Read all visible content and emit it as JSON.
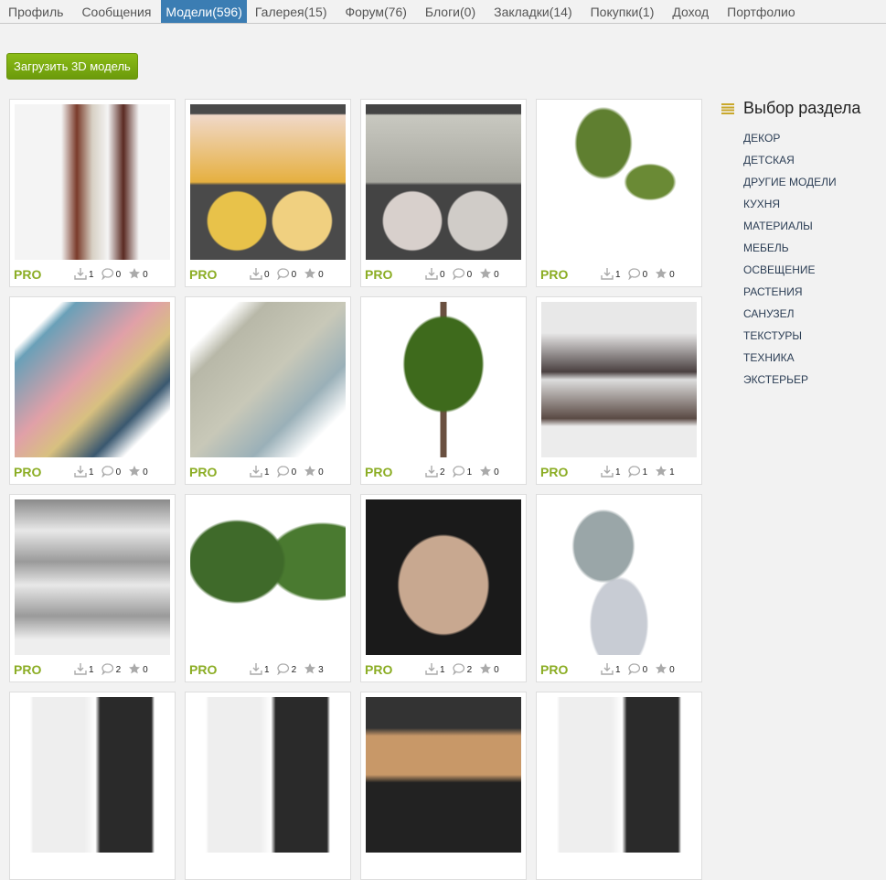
{
  "nav": [
    {
      "label": "Профиль"
    },
    {
      "label": "Сообщения"
    },
    {
      "label": "Модели(596)",
      "active": true
    },
    {
      "label": "Галерея(15)"
    },
    {
      "label": "Форум(76)"
    },
    {
      "label": "Блоги(0)"
    },
    {
      "label": "Закладки(14)"
    },
    {
      "label": "Покупки(1)"
    },
    {
      "label": "Доход"
    },
    {
      "label": "Портфолио"
    }
  ],
  "upload_label": "Загрузить 3D модель",
  "pro_label": "PRO",
  "models": [
    {
      "thumb": "pendant-lamps",
      "downloads": "1",
      "comments": "0",
      "likes": "0",
      "bg": "linear-gradient(90deg,#f4f4f4 30%,#7a3b2a 40%,#d7d0c4 50%,#f4f4f4 60%,#5a2a22 70%,#f4f4f4 80%)"
    },
    {
      "thumb": "abstract-paintings-yellow",
      "downloads": "0",
      "comments": "0",
      "likes": "0",
      "bg": "radial-gradient(circle at 30% 75%,#e8c24a 18%,transparent 19%),radial-gradient(circle at 72% 75%,#f0d080 18%,transparent 19%),linear-gradient(#4a4a4a 6%,#f0d8c8 7%,#e6b040 50%,#4a4a4a 52%)"
    },
    {
      "thumb": "abstract-paintings-grey",
      "downloads": "0",
      "comments": "0",
      "likes": "0",
      "bg": "radial-gradient(circle at 30% 75%,#d8d0cc 18%,transparent 19%),radial-gradient(circle at 72% 75%,#d0ccc8 18%,transparent 19%),linear-gradient(#444 6%,#c8c8c0 7%,#a8a8a0 50%,#444 52%)"
    },
    {
      "thumb": "palm-trees",
      "downloads": "1",
      "comments": "0",
      "likes": "0",
      "bg": "radial-gradient(ellipse at 40% 25%,#5f7f30 20%,transparent 22%),radial-gradient(ellipse at 70% 50%,#6a8a35 15%,transparent 17%),#fff"
    },
    {
      "thumb": "rugs-colorful",
      "downloads": "1",
      "comments": "0",
      "likes": "0",
      "bg": "linear-gradient(135deg,#fff 15%,#6aa0b8 20%,#e0a0a8 45%,#d8c080 60%,#3a5870 75%,#fff 85%)"
    },
    {
      "thumb": "rugs-vintage",
      "downloads": "1",
      "comments": "0",
      "likes": "0",
      "bg": "linear-gradient(135deg,#fff 15%,#b8b8a8 25%,#c8c8b8 50%,#9ab0b8 70%,#fff 85%)"
    },
    {
      "thumb": "tree",
      "downloads": "2",
      "comments": "1",
      "likes": "0",
      "bg": "radial-gradient(ellipse at 50% 40%,#3e6a1c 35%,transparent 37%),linear-gradient(90deg,transparent 48%,#6a5040 48%,#6a5040 52%,transparent 52%),#fff"
    },
    {
      "thumb": "kitchen",
      "downloads": "1",
      "comments": "1",
      "likes": "1",
      "bg": "linear-gradient(#e8e8e8 20%,#4a4040 45%,#ddd 50%,#5a4a44 75%,#ececec 80%)"
    },
    {
      "thumb": "sofas",
      "downloads": "1",
      "comments": "2",
      "likes": "0",
      "bg": "linear-gradient(#8a8a8a,#e8e8e8 20%,#9a9a9a 40%,#e8e8e8 55%,#9a9a9a 75%,#eee 90%)"
    },
    {
      "thumb": "potted-palms",
      "downloads": "1",
      "comments": "2",
      "likes": "3",
      "bg": "radial-gradient(ellipse at 30% 40%,#3f6a2a 30%,transparent 32%),radial-gradient(ellipse at 85% 40%,#4a7a30 28%,transparent 30%),#fff"
    },
    {
      "thumb": "brick-bbq",
      "downloads": "1",
      "comments": "2",
      "likes": "0",
      "bg": "radial-gradient(ellipse at 50% 55%,#c8a890 40%,transparent 42%),#1a1a1a"
    },
    {
      "thumb": "tables",
      "downloads": "1",
      "comments": "0",
      "likes": "0",
      "bg": "radial-gradient(ellipse at 40% 30%,#9aa6a8 22%,transparent 24%),radial-gradient(ellipse at 50% 80%,#c8ccd4 25%,transparent 27%),#fff"
    },
    {
      "thumb": "doors-white-black",
      "bg": "linear-gradient(90deg,#fff 10%,#eee 12%,#eee 45%,#fff 52%,#2a2a2a 55%,#2a2a2a 88%,#fff 90%)"
    },
    {
      "thumb": "doors-louvered",
      "bg": "linear-gradient(90deg,#fff 10%,#eee 12%,#eee 45%,#fff 52%,#2a2a2a 55%,#2a2a2a 88%,#fff 90%)"
    },
    {
      "thumb": "kitchen-dark",
      "bg": "linear-gradient(#333 20%,#c89868 25%,#c89868 50%,#222 55%)"
    },
    {
      "thumb": "doors-white-black-2",
      "bg": "linear-gradient(90deg,#fff 10%,#eee 12%,#eee 45%,#fff 52%,#2a2a2a 55%,#2a2a2a 88%,#fff 90%)"
    }
  ],
  "sidebar": {
    "title": "Выбор раздела",
    "items": [
      "ДЕКОР",
      "ДЕТСКАЯ",
      "ДРУГИЕ МОДЕЛИ",
      "КУХНЯ",
      "МАТЕРИАЛЫ",
      "МЕБЕЛЬ",
      "ОСВЕЩЕНИЕ",
      "РАСТЕНИЯ",
      "САНУЗЕЛ",
      "ТЕКСТУРЫ",
      "ТЕХНИКА",
      "ЭКСТЕРЬЕР"
    ]
  }
}
